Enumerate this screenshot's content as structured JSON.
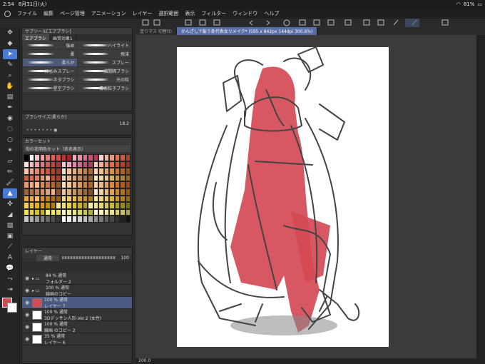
{
  "status": {
    "time": "2:54",
    "date": "8月31日(火)",
    "battery": "81%"
  },
  "menu": [
    "ファイル",
    "編集",
    "ページ管理",
    "アニメーション",
    "レイヤー",
    "選択範囲",
    "表示",
    "フィルター",
    "ウィンドウ",
    "ヘルプ"
  ],
  "subtool": {
    "header": "サブツール[エアブラシ]",
    "tabs": [
      "エアブラシ",
      "画質効果1"
    ],
    "brushes": [
      "強め",
      "ハイライト",
      "柔",
      "飛沫",
      "柔らか",
      "スプレー",
      "にじみスプレー",
      "描間隔ブラシ",
      "ネタブラシ",
      "光の粒",
      "星空ブラシ",
      "青系粒子ブラシ"
    ]
  },
  "brushsize": {
    "header": "ブラシサイズ[柔らか]",
    "value": "18.2"
  },
  "colorset": {
    "header": "カラーセット",
    "name": "旬の花明色セット（名名表示）"
  },
  "layer": {
    "header": "レイヤー",
    "blend": "通常",
    "opacity": "100",
    "rows": [
      {
        "pct": "84 %  通常",
        "name": "フォルダー 2"
      },
      {
        "pct": "100 %  通常",
        "name": "線画のコピー"
      },
      {
        "pct": "100 %  通常",
        "name": "レイヤー 7"
      },
      {
        "pct": "100 %  通常",
        "name": "3Dデッサン人形-Ver.2 (女性)"
      },
      {
        "pct": "100 %  通常",
        "name": "線画 のコピー 2"
      },
      {
        "pct": "35 %  通常",
        "name": "レイヤー 6"
      }
    ]
  },
  "canvas": {
    "tab1": "塗りマス 切替(t)",
    "tab2": "かんざしで髪う条代表女リメイク* (595 x 842px 144dpi 300.6%)",
    "zoom": "200.0"
  },
  "colors": {
    "red": "#d44a55",
    "accent": "#4a7cd4"
  }
}
